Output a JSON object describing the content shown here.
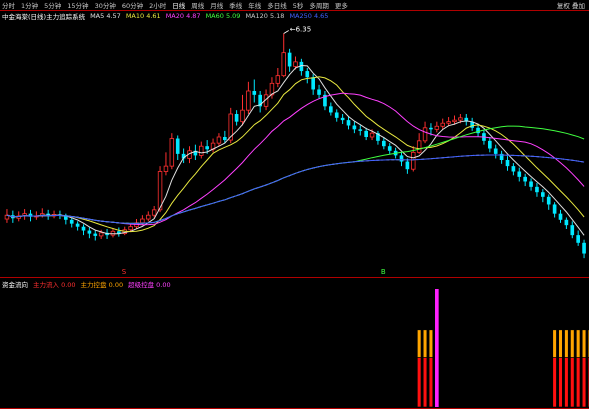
{
  "toolbar": {
    "periods": [
      "分时",
      "1分钟",
      "5分钟",
      "15分钟",
      "30分钟",
      "60分钟",
      "2小时",
      "日线",
      "周线",
      "月线",
      "季线",
      "年线",
      "多日线",
      "5秒",
      "多周期",
      "更多"
    ],
    "active_index": 7,
    "right_label": "复权 叠加"
  },
  "main_legend": {
    "title": "中金海棠(日线)主力追踪系统",
    "items": [
      {
        "label": "MA5",
        "value": "4.57",
        "color": "#e0e0e0"
      },
      {
        "label": "MA10",
        "value": "4.61",
        "color": "#e8e840"
      },
      {
        "label": "MA20",
        "value": "4.87",
        "color": "#ff40ff"
      },
      {
        "label": "MA60",
        "value": "5.09",
        "color": "#40ff40"
      },
      {
        "label": "MA120",
        "value": "5.18",
        "color": "#c8c8c8"
      },
      {
        "label": "MA250",
        "value": "4.65",
        "color": "#4060ff"
      }
    ]
  },
  "sub_legend": {
    "title": "资金流向",
    "items": [
      {
        "label": "主力流入",
        "value": "0.00",
        "color": "#ff3030"
      },
      {
        "label": "主力控盘",
        "value": "0.00",
        "color": "#ffa500"
      },
      {
        "label": "超级控盘",
        "value": "0.00",
        "color": "#ff40ff"
      }
    ]
  },
  "annotations": {
    "high_price": "6.35"
  },
  "markers": [
    {
      "text": "S",
      "color": "#ff3030",
      "candle_index": 20
    },
    {
      "text": "B",
      "color": "#40ff40",
      "candle_index": 64
    }
  ],
  "colors": {
    "up": "#ff3030",
    "down": "#00e8ff",
    "background": "#000000",
    "border": "#b00000"
  },
  "chart_data": {
    "type": "candlestick",
    "ylim": [
      3.2,
      6.5
    ],
    "candles": [
      [
        3.93,
        3.98,
        4.06,
        3.88
      ],
      [
        3.98,
        3.94,
        4.04,
        3.88
      ],
      [
        3.94,
        3.97,
        4.03,
        3.9
      ],
      [
        3.97,
        4.0,
        4.06,
        3.92
      ],
      [
        4.0,
        3.96,
        4.05,
        3.9
      ],
      [
        3.96,
        3.97,
        4.03,
        3.92
      ],
      [
        3.97,
        4.0,
        4.07,
        3.95
      ],
      [
        4.0,
        3.97,
        4.05,
        3.92
      ],
      [
        3.97,
        3.99,
        4.04,
        3.94
      ],
      [
        3.99,
        3.98,
        4.04,
        3.93
      ],
      [
        3.98,
        3.92,
        4.0,
        3.86
      ],
      [
        3.92,
        3.87,
        3.95,
        3.82
      ],
      [
        3.87,
        3.83,
        3.9,
        3.78
      ],
      [
        3.83,
        3.78,
        3.86,
        3.72
      ],
      [
        3.78,
        3.74,
        3.82,
        3.68
      ],
      [
        3.74,
        3.71,
        3.78,
        3.65
      ],
      [
        3.71,
        3.75,
        3.79,
        3.67
      ],
      [
        3.75,
        3.72,
        3.8,
        3.67
      ],
      [
        3.72,
        3.77,
        3.81,
        3.69
      ],
      [
        3.77,
        3.74,
        3.82,
        3.7
      ],
      [
        3.74,
        3.79,
        3.83,
        3.72
      ],
      [
        3.79,
        3.83,
        3.88,
        3.76
      ],
      [
        3.83,
        3.88,
        3.93,
        3.8
      ],
      [
        3.88,
        3.93,
        3.98,
        3.85
      ],
      [
        3.93,
        3.98,
        4.03,
        3.9
      ],
      [
        3.98,
        4.05,
        4.1,
        3.95
      ],
      [
        4.05,
        4.55,
        4.62,
        4.02
      ],
      [
        4.55,
        4.62,
        4.8,
        4.5
      ],
      [
        4.62,
        4.98,
        5.05,
        4.58
      ],
      [
        4.98,
        4.78,
        5.02,
        4.7
      ],
      [
        4.78,
        4.72,
        4.85,
        4.66
      ],
      [
        4.72,
        4.82,
        4.88,
        4.66
      ],
      [
        4.82,
        4.76,
        4.9,
        4.7
      ],
      [
        4.76,
        4.88,
        4.94,
        4.72
      ],
      [
        4.88,
        4.84,
        4.96,
        4.78
      ],
      [
        4.84,
        4.92,
        4.98,
        4.8
      ],
      [
        4.92,
        5.0,
        5.05,
        4.88
      ],
      [
        5.0,
        4.96,
        5.08,
        4.92
      ],
      [
        4.96,
        5.3,
        5.38,
        4.92
      ],
      [
        5.3,
        5.2,
        5.35,
        5.15
      ],
      [
        5.2,
        5.35,
        5.55,
        5.15
      ],
      [
        5.35,
        5.6,
        5.72,
        5.3
      ],
      [
        5.6,
        5.55,
        5.75,
        5.45
      ],
      [
        5.55,
        5.4,
        5.6,
        5.32
      ],
      [
        5.4,
        5.55,
        5.62,
        5.35
      ],
      [
        5.55,
        5.7,
        5.78,
        5.5
      ],
      [
        5.7,
        5.8,
        5.9,
        5.65
      ],
      [
        5.8,
        6.1,
        6.35,
        5.78
      ],
      [
        6.1,
        5.92,
        6.15,
        5.85
      ],
      [
        5.92,
        5.98,
        6.05,
        5.88
      ],
      [
        5.98,
        5.86,
        6.02,
        5.8
      ],
      [
        5.86,
        5.78,
        5.9,
        5.7
      ],
      [
        5.78,
        5.62,
        5.82,
        5.55
      ],
      [
        5.62,
        5.55,
        5.68,
        5.5
      ],
      [
        5.55,
        5.4,
        5.6,
        5.35
      ],
      [
        5.4,
        5.32,
        5.45,
        5.28
      ],
      [
        5.32,
        5.25,
        5.36,
        5.2
      ],
      [
        5.25,
        5.22,
        5.3,
        5.17
      ],
      [
        5.22,
        5.15,
        5.27,
        5.1
      ],
      [
        5.15,
        5.1,
        5.2,
        5.05
      ],
      [
        5.1,
        5.08,
        5.15,
        5.02
      ],
      [
        5.08,
        5.0,
        5.12,
        4.96
      ],
      [
        5.0,
        5.05,
        5.1,
        4.96
      ],
      [
        5.05,
        4.95,
        5.08,
        4.9
      ],
      [
        4.95,
        4.88,
        5.0,
        4.84
      ],
      [
        4.88,
        4.82,
        4.92,
        4.78
      ],
      [
        4.82,
        4.76,
        4.86,
        4.72
      ],
      [
        4.76,
        4.68,
        4.8,
        4.62
      ],
      [
        4.68,
        4.58,
        4.72,
        4.52
      ],
      [
        4.58,
        4.8,
        4.88,
        4.55
      ],
      [
        4.8,
        4.95,
        5.05,
        4.78
      ],
      [
        4.95,
        5.12,
        5.2,
        4.92
      ],
      [
        5.12,
        5.1,
        5.18,
        5.02
      ],
      [
        5.1,
        5.14,
        5.2,
        5.06
      ],
      [
        5.14,
        5.18,
        5.24,
        5.1
      ],
      [
        5.18,
        5.2,
        5.26,
        5.14
      ],
      [
        5.2,
        5.22,
        5.28,
        5.16
      ],
      [
        5.22,
        5.25,
        5.3,
        5.18
      ],
      [
        5.25,
        5.2,
        5.3,
        5.15
      ],
      [
        5.2,
        5.12,
        5.25,
        5.08
      ],
      [
        5.12,
        5.05,
        5.15,
        5.0
      ],
      [
        5.05,
        4.95,
        5.1,
        4.9
      ],
      [
        4.95,
        4.85,
        5.0,
        4.8
      ],
      [
        4.85,
        4.78,
        4.9,
        4.72
      ],
      [
        4.78,
        4.7,
        4.82,
        4.65
      ],
      [
        4.7,
        4.62,
        4.75,
        4.56
      ],
      [
        4.62,
        4.55,
        4.66,
        4.5
      ],
      [
        4.55,
        4.48,
        4.6,
        4.42
      ],
      [
        4.48,
        4.42,
        4.52,
        4.36
      ],
      [
        4.42,
        4.35,
        4.46,
        4.3
      ],
      [
        4.35,
        4.28,
        4.4,
        4.22
      ],
      [
        4.28,
        4.22,
        4.32,
        4.15
      ],
      [
        4.22,
        4.12,
        4.25,
        4.05
      ],
      [
        4.12,
        4.0,
        4.15,
        3.95
      ],
      [
        4.0,
        3.92,
        4.05,
        3.88
      ],
      [
        3.92,
        3.85,
        3.95,
        3.8
      ],
      [
        3.85,
        3.72,
        3.9,
        3.68
      ],
      [
        3.72,
        3.62,
        3.78,
        3.58
      ],
      [
        3.62,
        3.48,
        3.66,
        3.42
      ]
    ],
    "moving_averages": [
      {
        "name": "MA5",
        "period": 5,
        "color": "#e0e0e0"
      },
      {
        "name": "MA10",
        "period": 10,
        "color": "#e8e840"
      },
      {
        "name": "MA20",
        "period": 20,
        "color": "#ff40ff"
      },
      {
        "name": "MA60",
        "period": 60,
        "color": "#40ff40"
      },
      {
        "name": "MA120",
        "period": 120,
        "color": "#c8c8c8",
        "dashed": true
      },
      {
        "name": "MA250",
        "period": 250,
        "color": "#4060ff"
      }
    ],
    "sub_bars": [
      {
        "index": 70,
        "red": 0.35,
        "orange": 0.65,
        "magenta": false
      },
      {
        "index": 71,
        "red": 0.35,
        "orange": 0.65,
        "magenta": false
      },
      {
        "index": 72,
        "red": 0.35,
        "orange": 0.65,
        "magenta": false
      },
      {
        "index": 73,
        "red": 0.0,
        "orange": 0.0,
        "magenta": true
      },
      {
        "index": 93,
        "red": 0.35,
        "orange": 0.65,
        "magenta": false
      },
      {
        "index": 94,
        "red": 0.35,
        "orange": 0.65,
        "magenta": false
      },
      {
        "index": 95,
        "red": 0.35,
        "orange": 0.65,
        "magenta": false
      },
      {
        "index": 96,
        "red": 0.35,
        "orange": 0.65,
        "magenta": false
      },
      {
        "index": 97,
        "red": 0.35,
        "orange": 0.65,
        "magenta": false
      },
      {
        "index": 98,
        "red": 0.35,
        "orange": 0.65,
        "magenta": false
      },
      {
        "index": 99,
        "red": 0.35,
        "orange": 0.65,
        "magenta": false
      },
      {
        "index": 100,
        "red": 0.0,
        "orange": 0.0,
        "magenta": true
      }
    ]
  }
}
